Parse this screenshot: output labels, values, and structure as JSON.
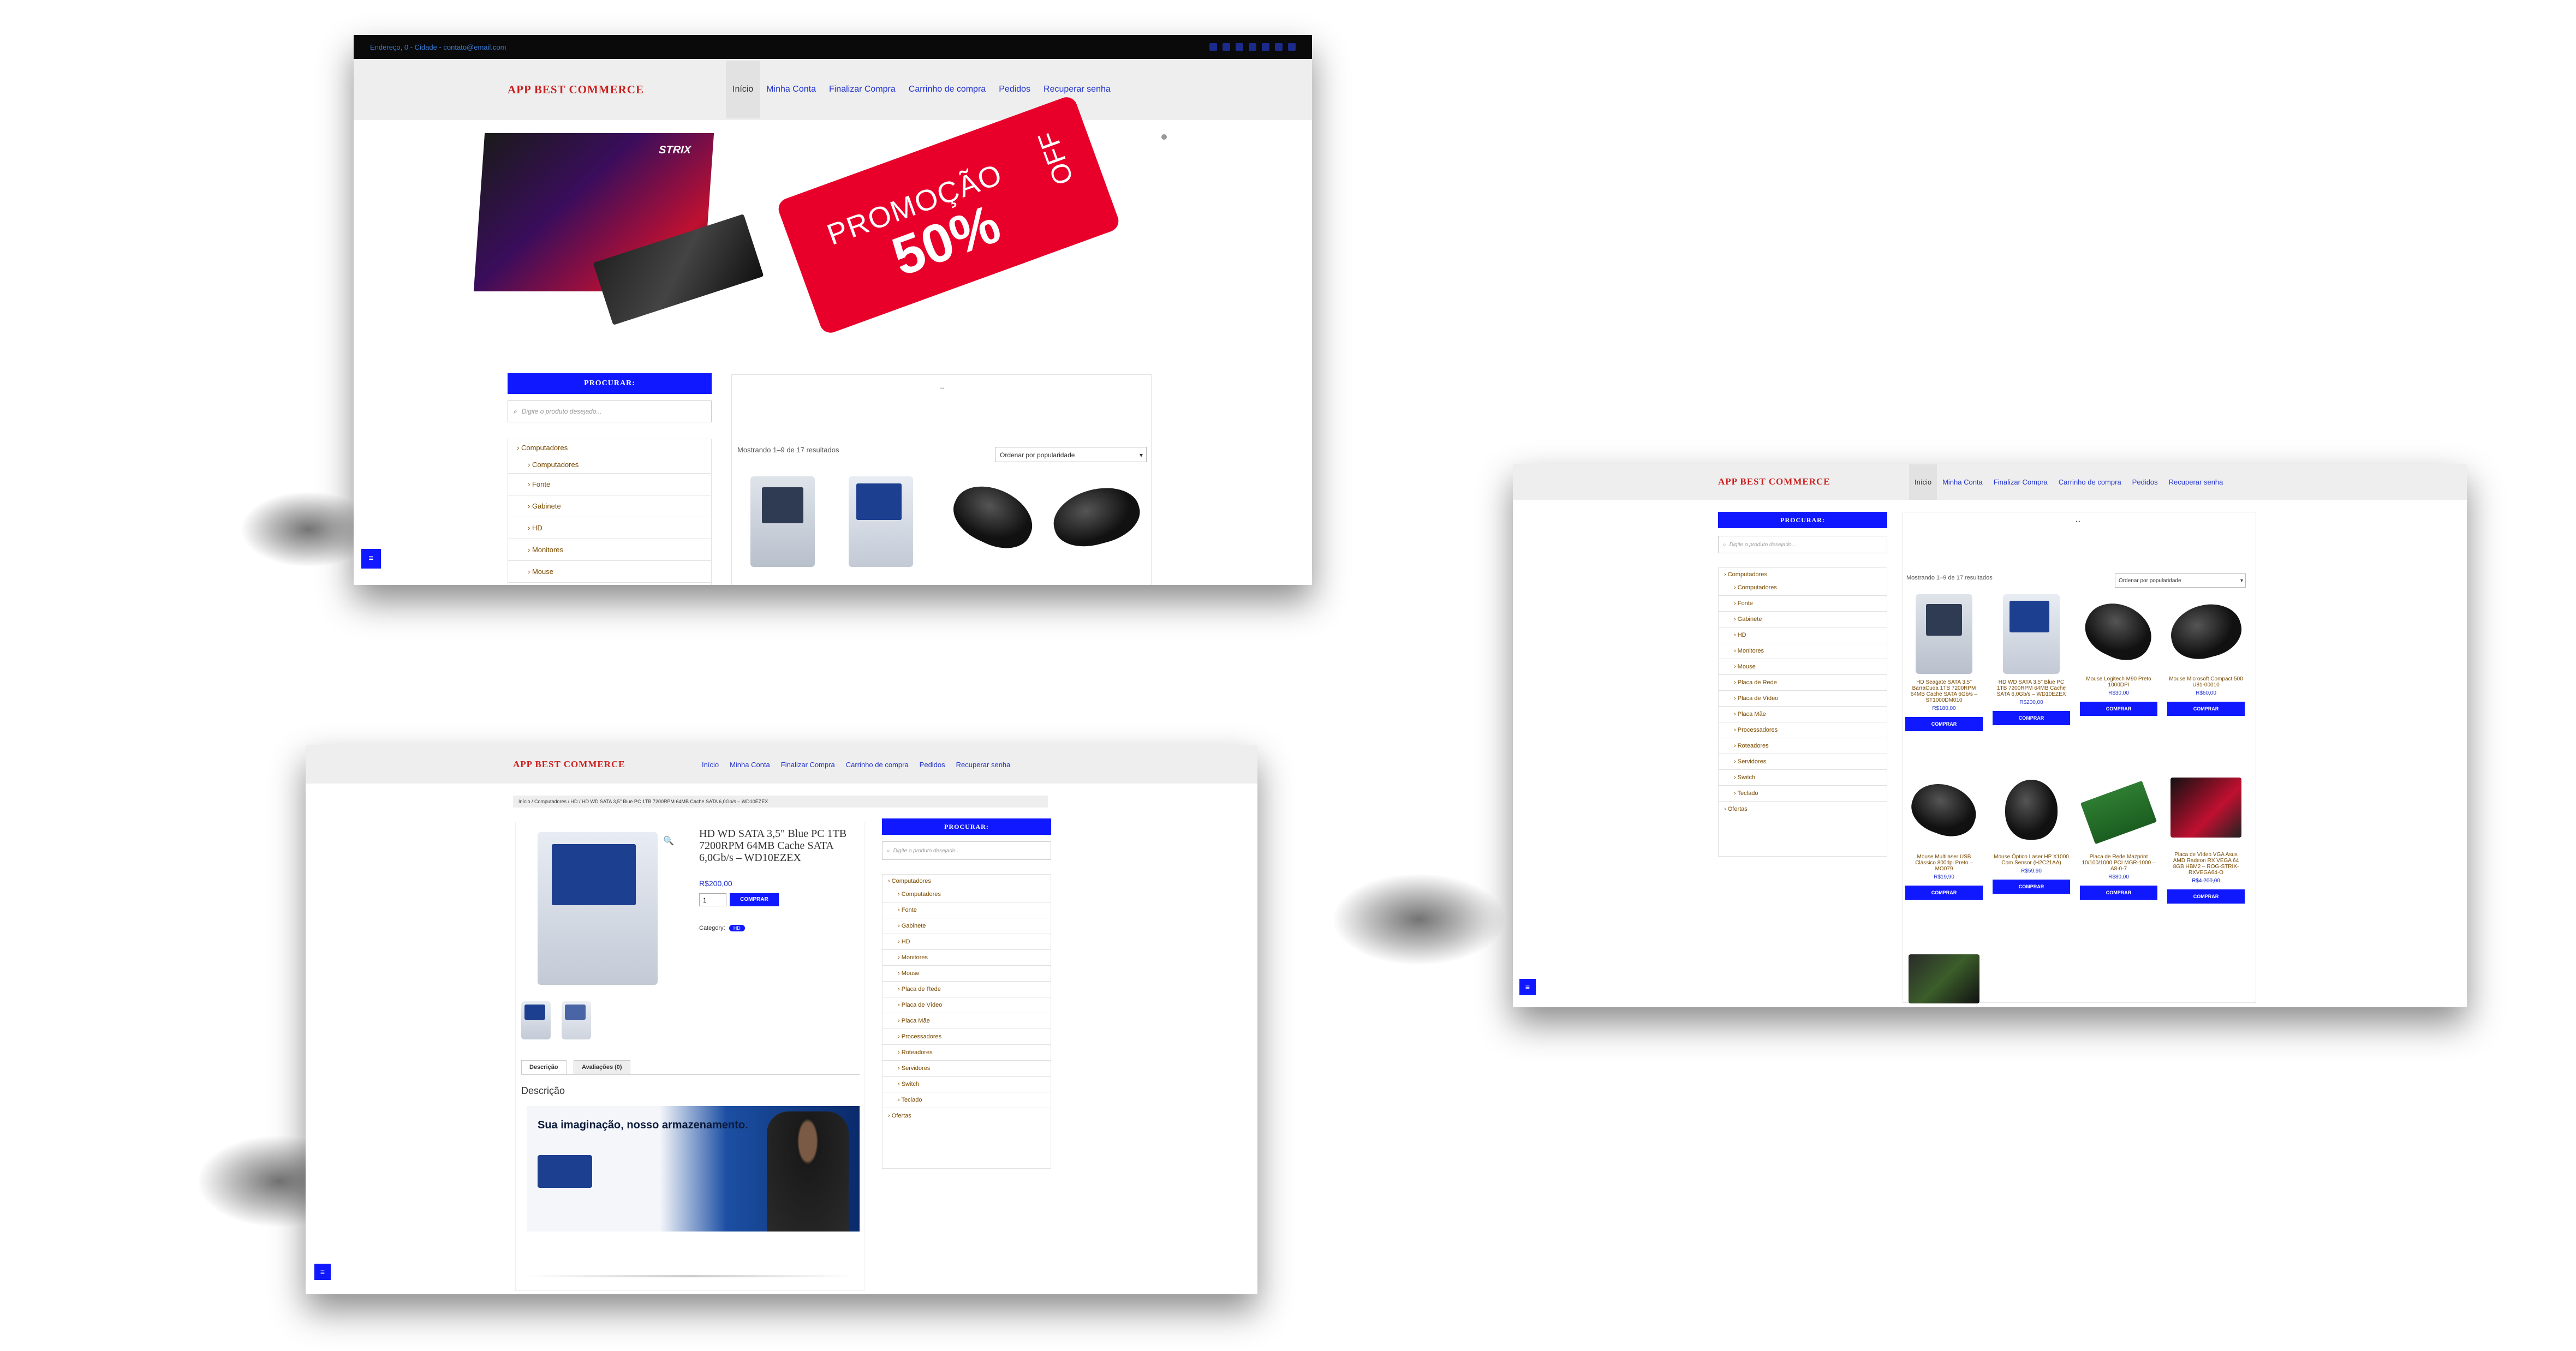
{
  "brand": {
    "logo": "APP BEST COMMERCE"
  },
  "topbar": {
    "contact_text": "Endereço, 0 - Cidade - contato@email.com"
  },
  "nav": {
    "items": [
      "Início",
      "Minha Conta",
      "Finalizar Compra",
      "Carrinho de compra",
      "Pedidos",
      "Recuperar senha"
    ]
  },
  "banner": {
    "promo_text": "PROMOÇÃO",
    "promo_percent": "50%",
    "promo_off": "OFF",
    "gpu_brand": "STRIX"
  },
  "sidebar": {
    "search_title": "PROCURAR:",
    "search_placeholder": "Digite o produto desejado...",
    "parent_category": "Computadores",
    "categories": [
      "Computadores",
      "Fonte",
      "Gabinete",
      "HD",
      "Monitores",
      "Mouse",
      "Placa de Rede",
      "Placa de Vídeo",
      "Placa Mãe",
      "Processadores",
      "Roteadores",
      "Servidores",
      "Switch",
      "Teclado"
    ],
    "offers": "Ofertas"
  },
  "shop": {
    "result_count": "Mostrando 1–9 de 17 resultados",
    "sort_label": "Ordenar por popularidade",
    "ellipsis": "...",
    "buy_label": "COMPRAR",
    "products": [
      {
        "name": "HD Seagate SATA 3,5\" BarraCuda 1TB 7200RPM 64MB Cache SATA 6Gb/s – ST1000DM010",
        "price": "R$180,00"
      },
      {
        "name": "HD WD SATA 3,5\" Blue PC 1TB 7200RPM 64MB Cache SATA 6,0Gb/s – WD10EZEX",
        "price": "R$200,00"
      },
      {
        "name": "Mouse Logitech M90 Preto 1000DPI",
        "price": "R$30,00"
      },
      {
        "name": "Mouse Microsoft Compact 500 U81-00010",
        "price": "R$60,00"
      },
      {
        "name": "Mouse Multilaser USB Clássico 800dpi Preto – MO079",
        "price": "R$19,90"
      },
      {
        "name": "Mouse Óptico Laser HP X1000 Com Sensor (H2C21AA)",
        "price": "R$59,90"
      },
      {
        "name": "Placa de Rede Mazprint 10/100/1000 PCI MGR-1000 – A8-0-7",
        "price": "R$80,00"
      },
      {
        "name": "Placa de Vídeo VGA Asus AMD Radeon RX VEGA 64 8GB HBM2 – ROG-STRIX-RXVEGA64-O",
        "price": "R$4.200,00"
      }
    ],
    "banner_float": "≡"
  },
  "product_page": {
    "breadcrumb": "Início / Computadores / HD / HD WD SATA 3,5\" Blue PC 1TB 7200RPM 64MB Cache SATA 6,0Gb/s – WD10EZEX",
    "title": "HD WD SATA 3,5\" Blue PC 1TB 7200RPM 64MB Cache SATA 6,0Gb/s – WD10EZEX",
    "price": "R$200,00",
    "qty": "1",
    "buy_label": "COMPRAR",
    "category_label": "Category:",
    "category_value": "HD",
    "tabs": [
      "Descrição",
      "Avaliações (0)"
    ],
    "description_heading": "Descrição",
    "description_banner": "Sua imaginação, nosso armazenamento."
  },
  "colors": {
    "accent_blue": "#1018ff",
    "logo_red": "#cc1f1f",
    "promo_red": "#e8002a",
    "category_brown": "#7a4a00"
  }
}
